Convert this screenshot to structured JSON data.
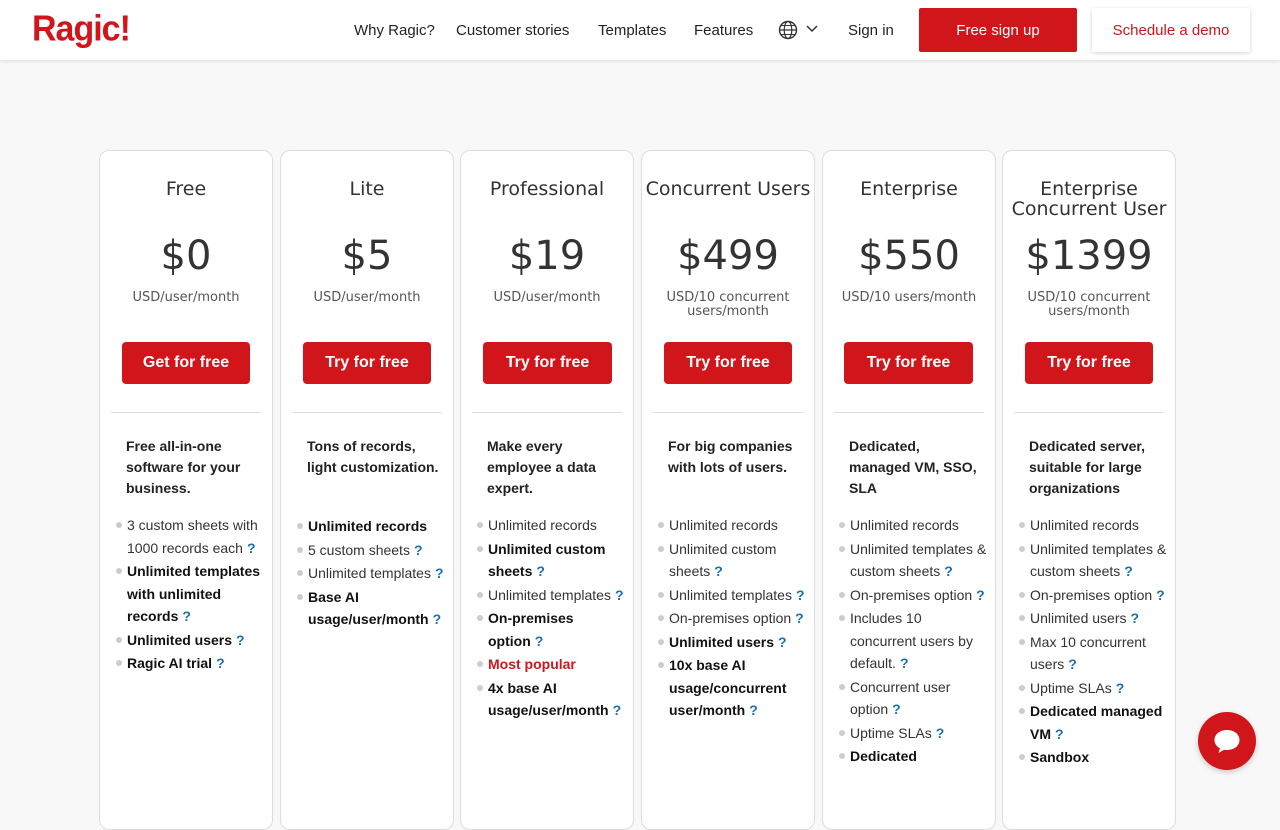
{
  "header": {
    "logo": "Ragic!",
    "nav": [
      "Why Ragic?",
      "Customer stories",
      "Templates",
      "Features"
    ],
    "signin": "Sign in",
    "signup": "Free sign up",
    "demo": "Schedule a demo",
    "icons": [
      "globe-icon",
      "chevron-down-icon"
    ]
  },
  "plans": [
    {
      "name": "Free",
      "price": "$0",
      "unit": "USD/user/month",
      "cta": "Get for free",
      "desc": "Free all-in-one software for your business.",
      "features": [
        {
          "text": "3 custom sheets with 1000 records each",
          "bold": false,
          "q": true
        },
        {
          "text": "Unlimited templates with unlimited records",
          "bold": true,
          "q": true
        },
        {
          "text": "Unlimited users",
          "bold": true,
          "q": true
        },
        {
          "text": "Ragic AI trial",
          "bold": true,
          "q": true
        }
      ]
    },
    {
      "name": "Lite",
      "price": "$5",
      "unit": "USD/user/month",
      "cta": "Try for free",
      "desc": "Tons of records, light customization.",
      "features": [
        {
          "text": "Unlimited records",
          "bold": true,
          "q": false
        },
        {
          "text": "5 custom sheets",
          "bold": false,
          "q": true
        },
        {
          "text": "Unlimited templates",
          "bold": false,
          "q": true
        },
        {
          "text": "Base AI usage/user/month",
          "bold": true,
          "q": true
        }
      ]
    },
    {
      "name": "Professional",
      "price": "$19",
      "unit": "USD/user/month",
      "cta": "Try for free",
      "desc": "Make every employee a data expert.",
      "features": [
        {
          "text": "Unlimited records",
          "bold": false,
          "q": false
        },
        {
          "text": "Unlimited custom sheets",
          "bold": true,
          "q": true
        },
        {
          "text": "Unlimited templates",
          "bold": false,
          "q": true
        },
        {
          "text": "On-premises option",
          "bold": true,
          "q": true
        },
        {
          "text": "Most popular",
          "bold": true,
          "q": false,
          "red": true
        },
        {
          "text": "4x base AI usage/user/month",
          "bold": true,
          "q": true
        }
      ]
    },
    {
      "name": "Concurrent Users",
      "price": "$499",
      "unit": "USD/10 concurrent users/month",
      "cta": "Try for free",
      "desc": "For big companies with lots of users.",
      "features": [
        {
          "text": "Unlimited records",
          "bold": false,
          "q": false
        },
        {
          "text": "Unlimited custom sheets",
          "bold": false,
          "q": true
        },
        {
          "text": "Unlimited templates",
          "bold": false,
          "q": true
        },
        {
          "text": "On-premises option",
          "bold": false,
          "q": true
        },
        {
          "text": "Unlimited users",
          "bold": true,
          "q": true
        },
        {
          "text": "10x base AI usage/concurrent user/month",
          "bold": true,
          "q": true
        }
      ]
    },
    {
      "name": "Enterprise",
      "price": "$550",
      "unit": "USD/10 users/month",
      "cta": "Try for free",
      "desc": "Dedicated, managed VM, SSO, SLA",
      "features": [
        {
          "text": "Unlimited records",
          "bold": false,
          "q": false
        },
        {
          "text": "Unlimited templates & custom sheets",
          "bold": false,
          "q": true
        },
        {
          "text": "On-premises option",
          "bold": false,
          "q": true
        },
        {
          "text": "Includes 10 concurrent users by default.",
          "bold": false,
          "q": true
        },
        {
          "text": "Concurrent user option",
          "bold": false,
          "q": true
        },
        {
          "text": "Uptime SLAs",
          "bold": false,
          "q": true
        },
        {
          "text": "Dedicated",
          "bold": true,
          "q": false
        }
      ]
    },
    {
      "name": "Enterprise Concurrent User",
      "price": "$1399",
      "unit": "USD/10 concurrent users/month",
      "cta": "Try for free",
      "desc": "Dedicated server, suitable for large organizations",
      "features": [
        {
          "text": "Unlimited records",
          "bold": false,
          "q": false
        },
        {
          "text": "Unlimited templates & custom sheets",
          "bold": false,
          "q": true
        },
        {
          "text": "On-premises option",
          "bold": false,
          "q": true
        },
        {
          "text": "Unlimited users",
          "bold": false,
          "q": true
        },
        {
          "text": "Max 10 concurrent users",
          "bold": false,
          "q": true
        },
        {
          "text": "Uptime SLAs",
          "bold": false,
          "q": true
        },
        {
          "text": "Dedicated managed VM",
          "bold": true,
          "q": true
        },
        {
          "text": "Sandbox",
          "bold": true,
          "q": false
        }
      ]
    }
  ],
  "help_mark": "?",
  "chat_icon": "chat-bubble-icon",
  "colors": {
    "brand": "#d0161b",
    "help": "#1a6fb0"
  }
}
